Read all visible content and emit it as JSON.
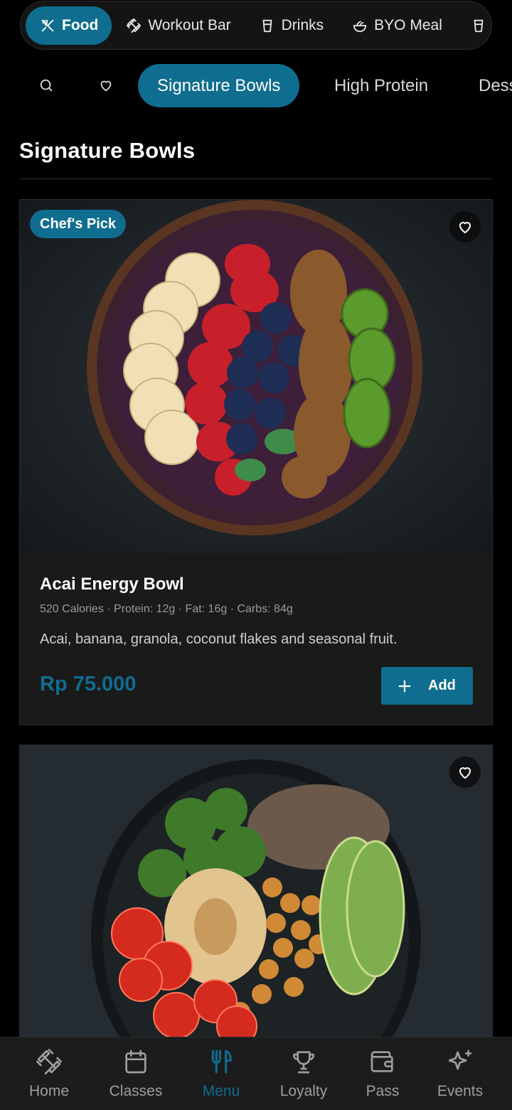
{
  "categories": [
    {
      "label": "Food",
      "icon": "utensils-crossed-icon",
      "active": true
    },
    {
      "label": "Workout Bar",
      "icon": "dumbbell-icon",
      "active": false
    },
    {
      "label": "Drinks",
      "icon": "cup-icon",
      "active": false
    },
    {
      "label": "BYO Meal",
      "icon": "salad-bowl-icon",
      "active": false
    },
    {
      "label": "",
      "icon": "cup-icon",
      "active": false
    }
  ],
  "subtabs": {
    "search_icon": "search-icon",
    "favorites_icon": "heart-icon",
    "items": [
      "Signature Bowls",
      "High Protein",
      "Dess"
    ]
  },
  "section_title": "Signature Bowls",
  "products": [
    {
      "name": "Acai Energy Bowl",
      "meta": "520 Calories · Protein: 12g · Fat: 16g · Carbs: 84g",
      "description": "Acai, banana, granola, coconut flakes and seasonal fruit.",
      "price": "Rp 75.000",
      "badge": "Chef's Pick",
      "add_label": "Add"
    },
    {
      "name": "",
      "badge": "",
      "image": "hummus-chickpea-buddha-bowl"
    }
  ],
  "bottom_nav": [
    {
      "label": "Home",
      "icon": "dumbbell-icon",
      "active": false
    },
    {
      "label": "Classes",
      "icon": "calendar-icon",
      "active": false
    },
    {
      "label": "Menu",
      "icon": "fork-knife-icon",
      "active": true
    },
    {
      "label": "Loyalty",
      "icon": "trophy-icon",
      "active": false
    },
    {
      "label": "Pass",
      "icon": "wallet-icon",
      "active": false
    },
    {
      "label": "Events",
      "icon": "sparkles-icon",
      "active": false
    }
  ],
  "colors": {
    "accent": "#0f6d8f",
    "background": "#000000",
    "card": "#1a1a1a",
    "muted_text": "#9a9a9a"
  }
}
